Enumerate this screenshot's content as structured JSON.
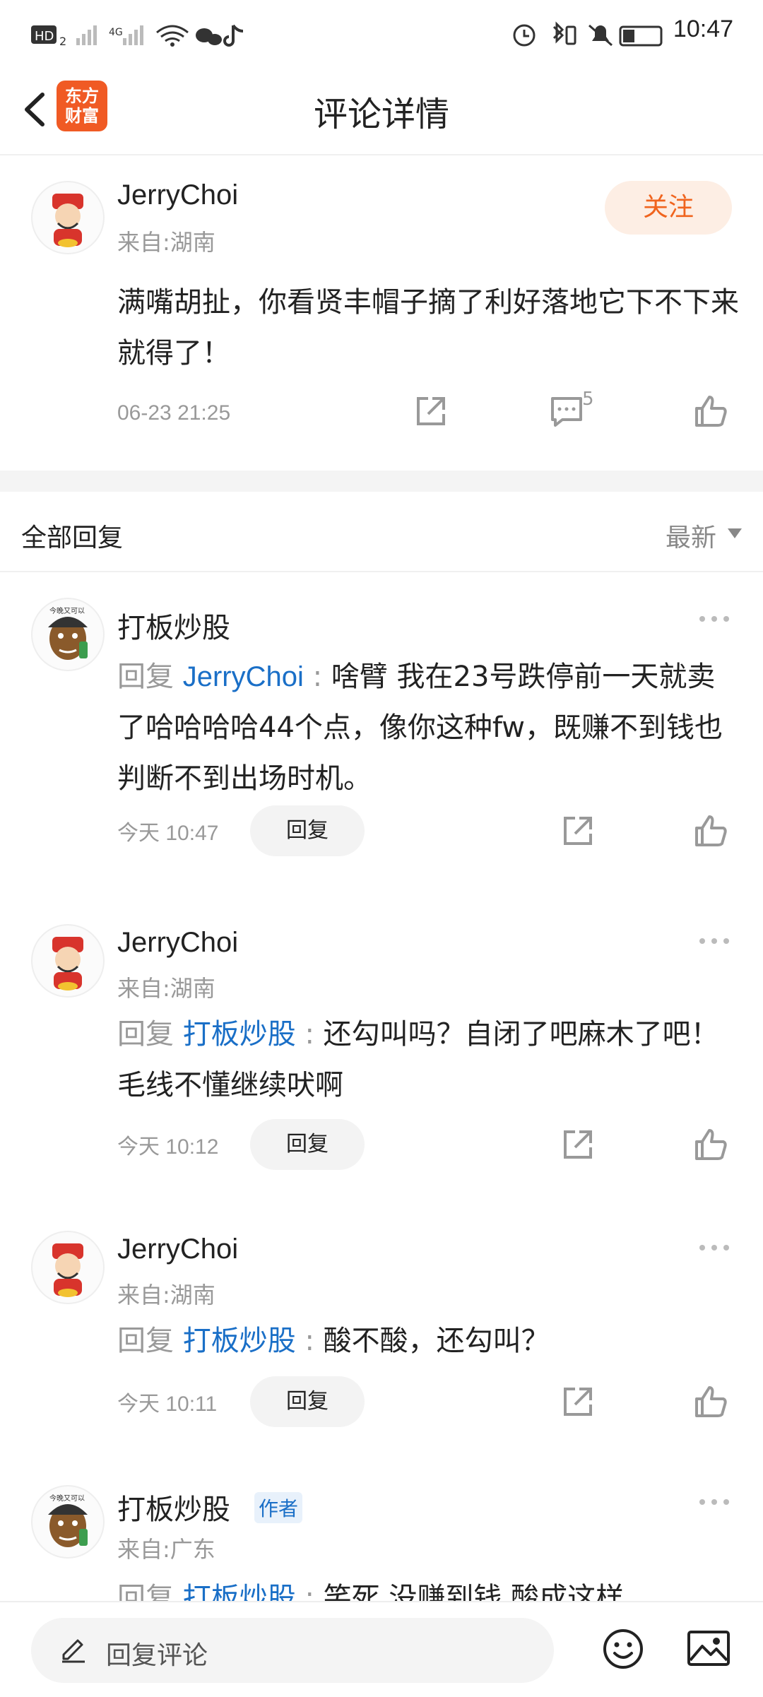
{
  "status_bar": {
    "time": "10:47"
  },
  "header": {
    "title": "评论详情",
    "logo_text_1": "东方",
    "logo_text_2": "财富"
  },
  "main_comment": {
    "user": "JerryChoi",
    "location": "来自:湖南",
    "follow_label": "关注",
    "text": "满嘴胡扯，你看贤丰帽子摘了利好落地它下不下来就得了！",
    "time": "06-23 21:25",
    "reply_count": "5"
  },
  "section": {
    "label": "全部回复",
    "sort_label": "最新"
  },
  "replies": [
    {
      "user": "打板炒股",
      "location": "",
      "prefix": "回复",
      "target": "JerryChoi",
      "sep": ":",
      "text": "啥臂 我在23号跌停前一天就卖了哈哈哈哈44个点，像你这种fw，既赚不到钱也判断不到出场时机。",
      "time": "今天 10:47",
      "reply_label": "回复"
    },
    {
      "user": "JerryChoi",
      "location": "来自:湖南",
      "prefix": "回复",
      "target": "打板炒股",
      "sep": ":",
      "text": "还勾叫吗？自闭了吧麻木了吧！毛线不懂继续吠啊",
      "time": "今天 10:12",
      "reply_label": "回复"
    },
    {
      "user": "JerryChoi",
      "location": "来自:湖南",
      "prefix": "回复",
      "target": "打板炒股",
      "sep": ":",
      "text": "酸不酸，还勾叫？",
      "time": "今天 10:11",
      "reply_label": "回复"
    },
    {
      "user": "打板炒股",
      "author_tag": "作者",
      "location": "来自:广东",
      "prefix": "回复",
      "target": "打板炒股",
      "sep": ":",
      "text": "笑死 没赚到钱 酸成这样"
    }
  ],
  "bottom_bar": {
    "placeholder": "回复评论"
  },
  "colors": {
    "accent": "#f0641e",
    "link": "#1a6fc7",
    "muted": "#999999"
  }
}
